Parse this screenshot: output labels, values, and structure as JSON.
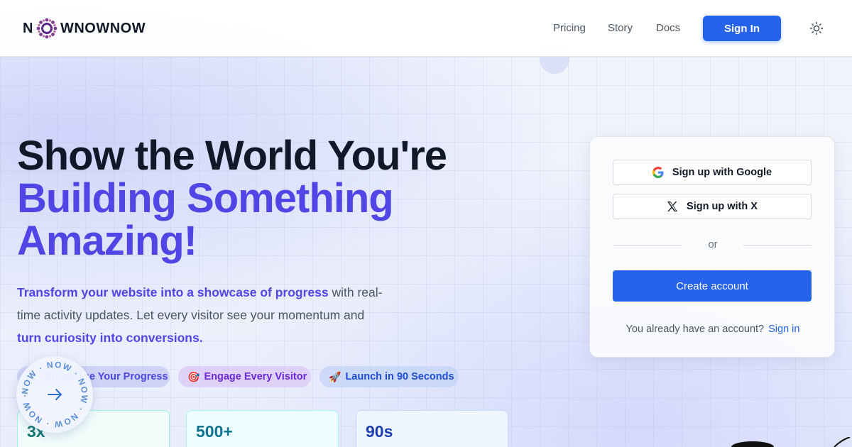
{
  "brand": {
    "name_prefix": "N",
    "name_suffix": "WNOWNOW",
    "accent_color": "#7b3b8f"
  },
  "nav": {
    "links": [
      "Pricing",
      "Story",
      "Docs"
    ],
    "signin_label": "Sign In",
    "theme_icon": "sun-icon"
  },
  "hero": {
    "title_line1": "Show the World You're",
    "title_line2": "Building Something",
    "title_line3": "Amazing!",
    "desc_strong1": "Transform your website into a showcase of progress",
    "desc_text1": " with real-time activity updates. Let every visitor see your momentum and ",
    "desc_strong2": "turn curiosity into conversions."
  },
  "pills": [
    {
      "emoji": "",
      "label": "Showcase Your Progress"
    },
    {
      "emoji": "🎯",
      "label": "Engage Every Visitor"
    },
    {
      "emoji": "🚀",
      "label": "Launch in 90 Seconds"
    }
  ],
  "stats": [
    {
      "value": "3x"
    },
    {
      "value": "500+"
    },
    {
      "value": "90s"
    }
  ],
  "badge": {
    "ring_text": "NOW · NOW · NOW · NOW · NOW · ",
    "arrow_icon": "arrow-right-icon"
  },
  "signup": {
    "google_label": "Sign up with Google",
    "x_label": "Sign up with X",
    "or_label": "or",
    "create_label": "Create account",
    "have_account": "You already have an account?",
    "signin_link": "Sign in"
  },
  "colors": {
    "primary": "#2563eb",
    "indigo": "#4f46e5"
  }
}
